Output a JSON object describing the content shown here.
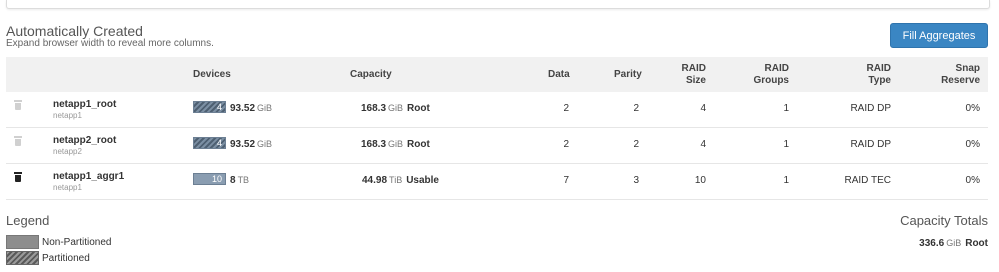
{
  "section": {
    "title": "Automatically Created",
    "subtitle": "Expand browser width to reveal more columns.",
    "fill_button": "Fill Aggregates"
  },
  "columns": {
    "devices": "Devices",
    "capacity": "Capacity",
    "data": "Data",
    "parity": "Parity",
    "raid_size": [
      "RAID",
      "Size"
    ],
    "raid_groups": [
      "RAID",
      "Groups"
    ],
    "raid_type": [
      "RAID",
      "Type"
    ],
    "snap_reserve": [
      "Snap",
      "Reserve"
    ]
  },
  "rows": [
    {
      "name": "netapp1_root",
      "node": "netapp1",
      "delete_icon": "trash-icon",
      "icon_state": "disabled",
      "device_count": "4",
      "device_style": "partitioned",
      "device_size": "93.52",
      "device_unit": "GiB",
      "capacity": "168.3",
      "capacity_unit": "GiB",
      "capacity_label": "Root",
      "data": "2",
      "parity": "2",
      "raid_size": "4",
      "raid_groups": "1",
      "raid_type": "RAID DP",
      "snap_reserve": "0%"
    },
    {
      "name": "netapp2_root",
      "node": "netapp2",
      "delete_icon": "trash-icon",
      "icon_state": "disabled",
      "device_count": "4",
      "device_style": "partitioned",
      "device_size": "93.52",
      "device_unit": "GiB",
      "capacity": "168.3",
      "capacity_unit": "GiB",
      "capacity_label": "Root",
      "data": "2",
      "parity": "2",
      "raid_size": "4",
      "raid_groups": "1",
      "raid_type": "RAID DP",
      "snap_reserve": "0%"
    },
    {
      "name": "netapp1_aggr1",
      "node": "netapp1",
      "delete_icon": "trash-icon",
      "icon_state": "enabled",
      "device_count": "10",
      "device_style": "non-partitioned",
      "device_size": "8",
      "device_unit": "TB",
      "capacity": "44.98",
      "capacity_unit": "TiB",
      "capacity_label": "Usable",
      "data": "7",
      "parity": "3",
      "raid_size": "10",
      "raid_groups": "1",
      "raid_type": "RAID TEC",
      "snap_reserve": "0%"
    }
  ],
  "legend": {
    "title": "Legend",
    "non_partitioned": "Non-Partitioned",
    "partitioned": "Partitioned"
  },
  "capacity_totals": {
    "title": "Capacity Totals",
    "value": "336.6",
    "unit": "GiB",
    "label": "Root"
  },
  "colors": {
    "button": "#3a86c3",
    "header_bg": "#f1f1f1",
    "device_bar": "#7b8fa3"
  }
}
